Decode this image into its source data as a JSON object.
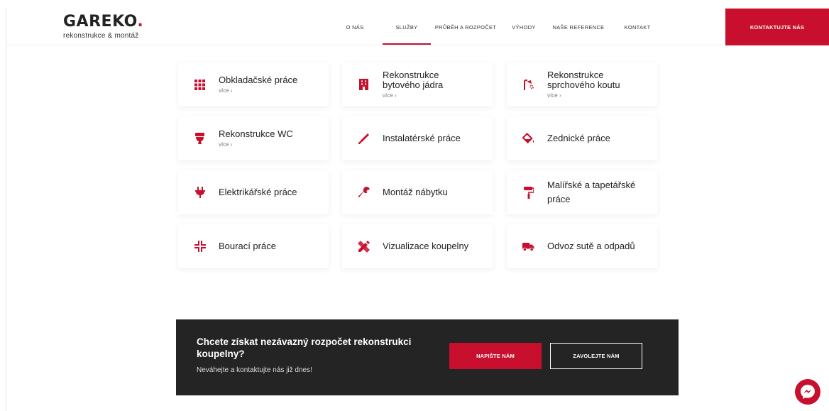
{
  "brand": {
    "logo_prefix": "GA",
    "logo_bold": "REKO",
    "logo_dot": ".",
    "tagline": "rekonstrukce & montáž",
    "accent_color": "#c8102e"
  },
  "nav": {
    "items": [
      {
        "label": "O NÁS",
        "active": false
      },
      {
        "label": "SLUŽBY",
        "active": true
      },
      {
        "label": "PRŮBĚH A ROZPOČET",
        "active": false
      },
      {
        "label": "VÝHODY",
        "active": false
      },
      {
        "label": "NAŠE REFERENCE",
        "active": false
      },
      {
        "label": "KONTAKT",
        "active": false
      }
    ],
    "cta_label": "KONTAKTUJTE NÁS"
  },
  "services": [
    {
      "title": "Obkladačské práce",
      "more": "více ›",
      "icon": "tiles-icon"
    },
    {
      "title": "Rekonstrukce bytového jádra",
      "more": "více ›",
      "icon": "building-icon"
    },
    {
      "title": "Rekonstrukce sprchového koutu",
      "more": "více ›",
      "icon": "shower-icon"
    },
    {
      "title": "Rekonstrukce WC",
      "more": "více ›",
      "icon": "toilet-icon"
    },
    {
      "title": "Instalatérské práce",
      "more": "",
      "icon": "pipe-icon"
    },
    {
      "title": "Zednické práce",
      "more": "",
      "icon": "paint-bucket-icon"
    },
    {
      "title": "Elektrikářské práce",
      "more": "",
      "icon": "plug-icon"
    },
    {
      "title": "Montáž nábytku",
      "more": "",
      "icon": "wrench-icon"
    },
    {
      "title": "Malířské a tapetářské práce",
      "more": "",
      "icon": "paint-roller-icon"
    },
    {
      "title": "Bourací práce",
      "more": "",
      "icon": "compress-icon"
    },
    {
      "title": "Vizualizace koupelny",
      "more": "",
      "icon": "design-tools-icon"
    },
    {
      "title": "Odvoz sutě a odpadů",
      "more": "",
      "icon": "truck-icon"
    }
  ],
  "banner": {
    "title": "Chcete získat nezávazný rozpočet rekonstrukci koupelny?",
    "subtitle": "Neváhejte a kontaktujte nás již dnes!",
    "write_label": "NAPIŠTE NÁM",
    "call_label": "ZAVOLEJTE NÁM"
  },
  "chat": {
    "icon": "messenger-icon"
  }
}
